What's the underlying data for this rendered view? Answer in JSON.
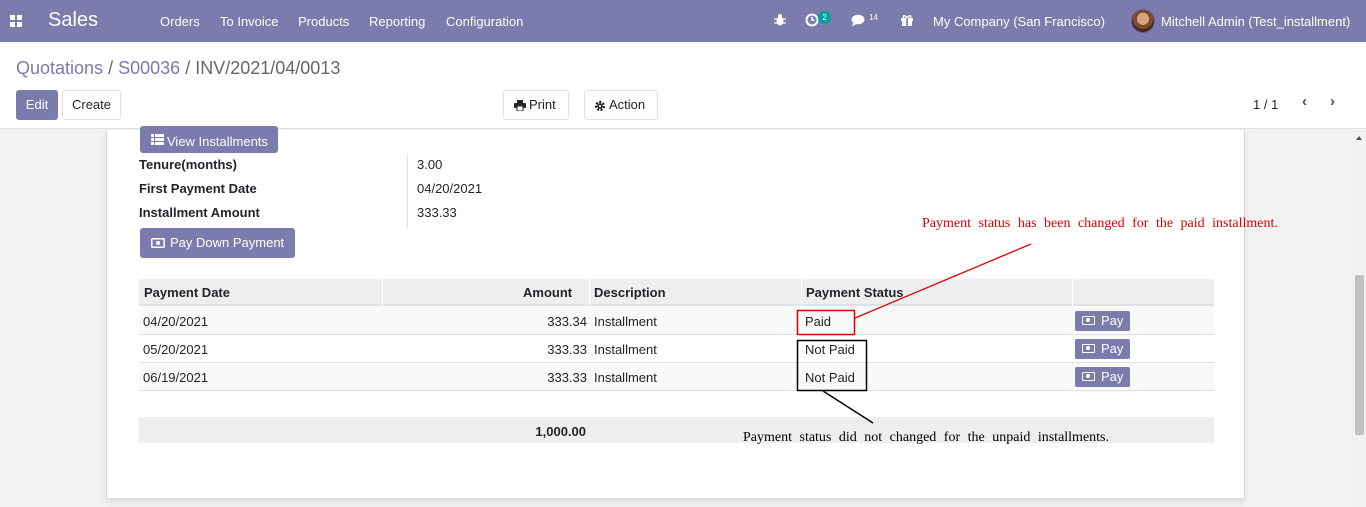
{
  "navbar": {
    "app_name": "Sales",
    "menu": [
      "Orders",
      "To Invoice",
      "Products",
      "Reporting",
      "Configuration"
    ],
    "activity_count": "2",
    "messages_count": "14",
    "company": "My Company (San Francisco)",
    "user": "Mitchell Admin (Test_installment)"
  },
  "breadcrumb": {
    "items": [
      "Quotations",
      "S00036"
    ],
    "separator": "/",
    "current": "INV/2021/04/0013"
  },
  "buttons": {
    "edit": "Edit",
    "create": "Create",
    "print": "Print",
    "action": "Action"
  },
  "pager": {
    "value": "1 / 1"
  },
  "form": {
    "view_installments_label": "View Installments",
    "fields": [
      {
        "label": "Tenure(months)",
        "value": "3.00"
      },
      {
        "label": "First Payment Date",
        "value": "04/20/2021"
      },
      {
        "label": "Installment Amount",
        "value": "333.33"
      }
    ],
    "pay_down_payment_label": "Pay Down Payment"
  },
  "table": {
    "headers": [
      "Payment Date",
      "Amount",
      "Description",
      "Payment Status"
    ],
    "pay_label": "Pay",
    "rows": [
      {
        "date": "04/20/2021",
        "amount": "333.34",
        "description": "Installment",
        "status": "Paid"
      },
      {
        "date": "05/20/2021",
        "amount": "333.33",
        "description": "Installment",
        "status": "Not Paid"
      },
      {
        "date": "06/19/2021",
        "amount": "333.33",
        "description": "Installment",
        "status": "Not Paid"
      }
    ],
    "total": "1,000.00"
  },
  "annotations": {
    "paid_note": "Payment status has been changed for the paid installment.",
    "unpaid_note": "Payment status did not changed for the unpaid installments.",
    "paid_color": "#e00000",
    "unpaid_color": "#000000"
  },
  "colors": {
    "brand": "#7c7bad",
    "activity_badge": "#00a09d"
  }
}
